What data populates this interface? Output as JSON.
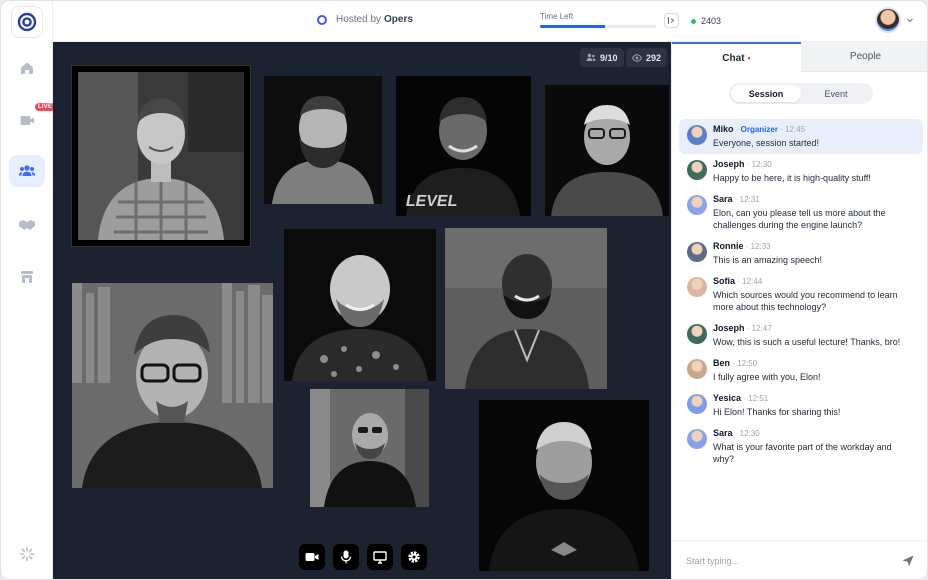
{
  "topbar": {
    "host_prefix": "Hosted by",
    "host_name": "Opers",
    "time_left_label": "Time Left",
    "time_left_progress": 0.56,
    "online_count": "2403"
  },
  "sidebar": {
    "items": [
      {
        "icon": "home-icon"
      },
      {
        "icon": "live-stream-icon",
        "badge": "LIVE"
      },
      {
        "icon": "people-group-icon"
      },
      {
        "icon": "handshake-icon"
      },
      {
        "icon": "booth-icon"
      }
    ],
    "footer_icon": "loader-icon"
  },
  "stage": {
    "participants_stat": "9/10",
    "viewers_stat": "292",
    "controls": [
      "camera-icon",
      "microphone-icon",
      "screen-share-icon",
      "settings-icon"
    ]
  },
  "panel": {
    "tabs": [
      {
        "label": "Chat",
        "active": true
      },
      {
        "label": "People",
        "active": false
      }
    ],
    "segments": [
      {
        "label": "Session",
        "active": true
      },
      {
        "label": "Event",
        "active": false
      }
    ],
    "messages": [
      {
        "name": "Miko",
        "role": "Organizer",
        "time": "12:45",
        "text": "Everyone, session started!",
        "highlight": true,
        "avatar_color": "#5b7fc4"
      },
      {
        "name": "Joseph",
        "role": "",
        "time": "12:30",
        "text": "Happy to be here, it is high-quality stuff!",
        "avatar_color": "#3f6b5a"
      },
      {
        "name": "Sara",
        "role": "",
        "time": "12:31",
        "text": "Elon, can you please tell us more about the challenges during the engine launch?",
        "avatar_color": "#8aa3e6"
      },
      {
        "name": "Ronnie",
        "role": "",
        "time": "12:33",
        "text": "This is an amazing speech!",
        "avatar_color": "#5c6b86"
      },
      {
        "name": "Sofia",
        "role": "",
        "time": "12:44",
        "text": "Which sources would you recommend to learn more about this technology?",
        "avatar_color": "#d9b6a3"
      },
      {
        "name": "Joseph",
        "role": "",
        "time": "12:47",
        "text": "Wow, this is such a useful lecture! Thanks, bro!",
        "avatar_color": "#3f6b5a"
      },
      {
        "name": "Ben",
        "role": "",
        "time": "12:50",
        "text": "I fully agree with you, Elon!",
        "avatar_color": "#c9a78d"
      },
      {
        "name": "Yesica",
        "role": "",
        "time": "12:51",
        "text": "Hi Elon! Thanks for sharing this!",
        "avatar_color": "#7c9de8"
      },
      {
        "name": "Sara",
        "role": "",
        "time": "12:30",
        "text": "What is your favorite part of the workday and why?",
        "avatar_color": "#8aa3e6"
      }
    ],
    "composer_placeholder": "Start typing..."
  }
}
